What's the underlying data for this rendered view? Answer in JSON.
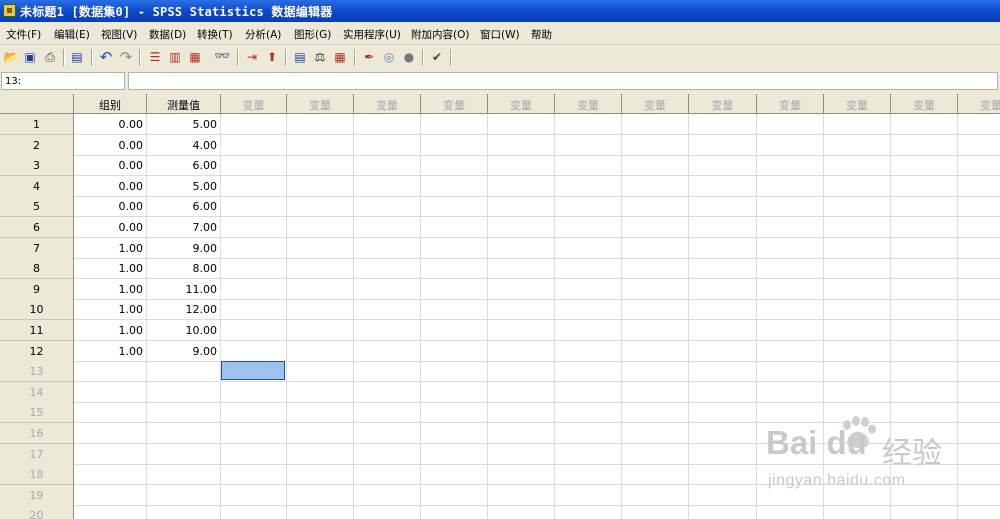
{
  "window": {
    "title": "未标题1 [数据集0] - SPSS Statistics 数据编辑器"
  },
  "menubar": {
    "items": [
      "文件(F)",
      "编辑(E)",
      "视图(V)",
      "数据(D)",
      "转换(T)",
      "分析(A)",
      "图形(G)",
      "实用程序(U)",
      "附加内容(O)",
      "窗口(W)",
      "帮助"
    ]
  },
  "toolbar": {
    "icons": [
      "open-icon",
      "save-icon",
      "print-icon",
      "dialog-recall-icon",
      "undo-icon",
      "redo-icon",
      "goto-case-icon",
      "goto-variable-icon",
      "variables-icon",
      "find-icon",
      "insert-cases-icon",
      "insert-variable-icon",
      "split-file-icon",
      "weight-cases-icon",
      "select-cases-icon",
      "value-labels-icon",
      "use-sets-icon",
      "show-all-icon",
      "spell-check-icon"
    ]
  },
  "cell_editor": {
    "reference": "13:",
    "value": ""
  },
  "grid": {
    "columns": [
      "组别",
      "测量值",
      "变量",
      "变量",
      "变量",
      "变量",
      "变量",
      "变量",
      "变量",
      "变量",
      "变量",
      "变量",
      "变量",
      "变量"
    ],
    "row_numbers": [
      "1",
      "2",
      "3",
      "4",
      "5",
      "6",
      "7",
      "8",
      "9",
      "10",
      "11",
      "12",
      "13",
      "14",
      "15",
      "16",
      "17",
      "18",
      "19",
      "20"
    ],
    "rows": [
      [
        "0.00",
        "5.00"
      ],
      [
        "0.00",
        "4.00"
      ],
      [
        "0.00",
        "6.00"
      ],
      [
        "0.00",
        "5.00"
      ],
      [
        "0.00",
        "6.00"
      ],
      [
        "0.00",
        "7.00"
      ],
      [
        "1.00",
        "9.00"
      ],
      [
        "1.00",
        "8.00"
      ],
      [
        "1.00",
        "11.00"
      ],
      [
        "1.00",
        "12.00"
      ],
      [
        "1.00",
        "10.00"
      ],
      [
        "1.00",
        "9.00"
      ]
    ],
    "selected_cell": {
      "row": "13",
      "column": "变量"
    }
  },
  "watermark": {
    "brand": "Bai du",
    "brand_cn": "经验",
    "url": "jingyan.baidu.com"
  }
}
